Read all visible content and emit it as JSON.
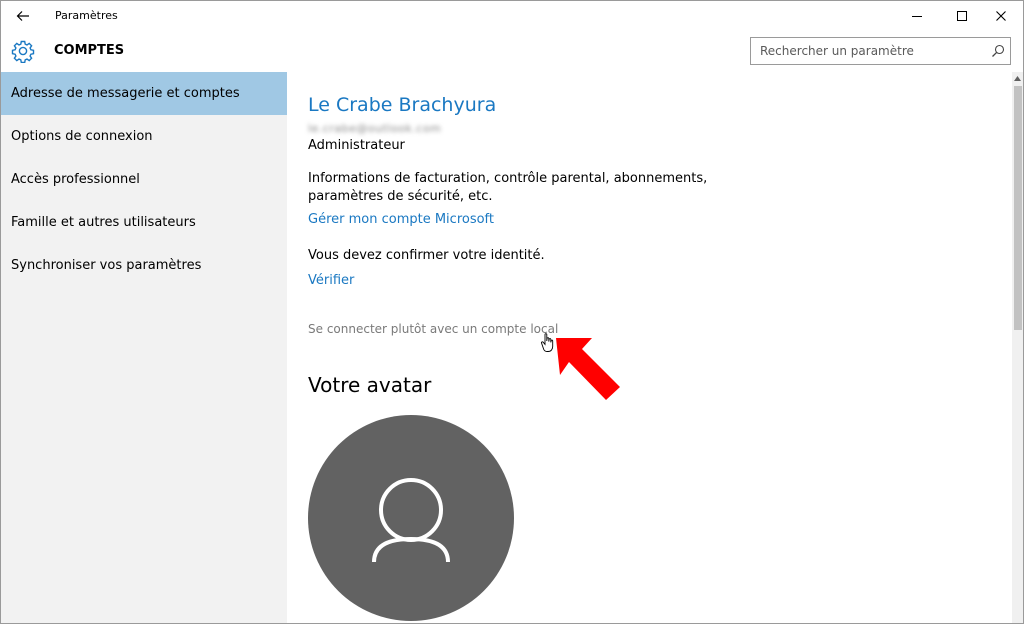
{
  "window": {
    "title": "Paramètres",
    "back_icon": "back-arrow-icon",
    "controls": [
      "minimize-icon",
      "maximize-icon",
      "close-icon"
    ]
  },
  "header": {
    "section_title": "COMPTES",
    "section_icon": "gear-icon",
    "search": {
      "placeholder": "Rechercher un paramètre",
      "value": "",
      "icon": "search-icon"
    }
  },
  "sidebar": {
    "items": [
      {
        "label": "Adresse de messagerie et comptes",
        "selected": true
      },
      {
        "label": "Options de connexion",
        "selected": false
      },
      {
        "label": "Accès professionnel",
        "selected": false
      },
      {
        "label": "Famille et autres utilisateurs",
        "selected": false
      },
      {
        "label": "Synchroniser vos paramètres",
        "selected": false
      }
    ]
  },
  "main": {
    "user_name": "Le Crabe Brachyura",
    "user_email": "le.crabe@outlook.com",
    "user_role": "Administrateur",
    "billing_info_line1": "Informations de facturation, contrôle parental, abonnements,",
    "billing_info_line2": "paramètres de sécurité, etc.",
    "manage_account_link": "Gérer mon compte Microsoft",
    "confirm_identity_text": "Vous devez confirmer votre identité.",
    "verify_link": "Vérifier",
    "local_account_link": "Se connecter plutôt avec un compte local",
    "avatar_heading": "Votre avatar"
  },
  "colors": {
    "accent": "#1a78c2",
    "selected_nav": "#a0c8e4",
    "sidebar_bg": "#f2f2f2",
    "avatar_bg": "#626262",
    "annotation_arrow": "#ff0000"
  }
}
